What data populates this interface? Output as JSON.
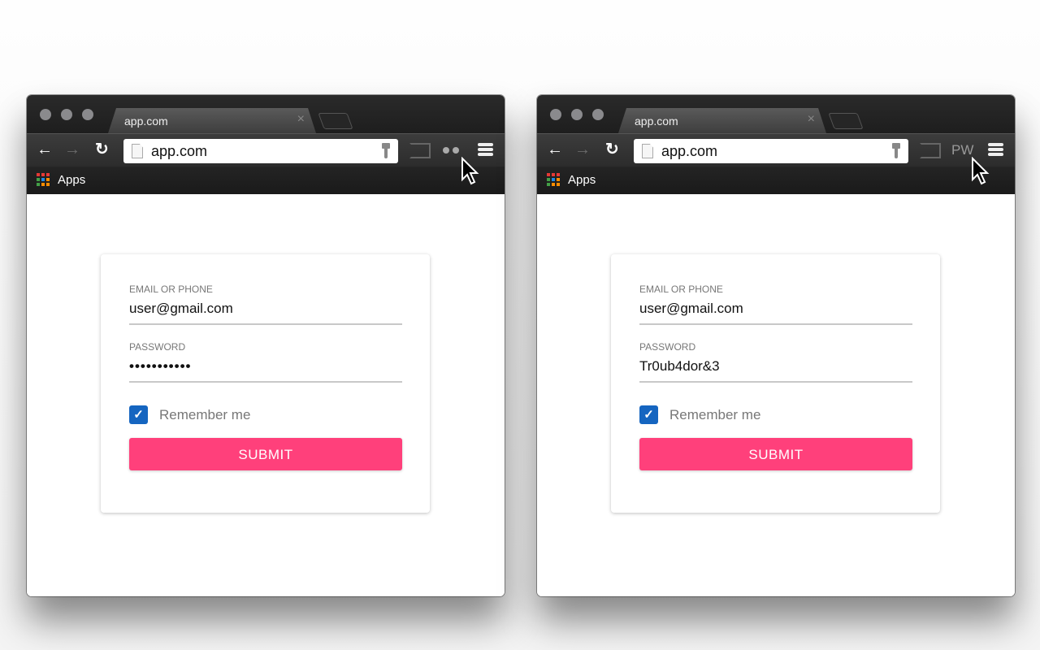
{
  "windows": [
    {
      "tab_title": "app.com",
      "tab_close": "×",
      "url": "app.com",
      "extension": {
        "type": "dots",
        "label": ""
      },
      "bookmarks_label": "Apps",
      "form": {
        "email_label": "EMAIL OR PHONE",
        "email_value": "user@gmail.com",
        "password_label": "PASSWORD",
        "password_value": "•••••••••••",
        "remember_label": "Remember me",
        "remember_checked": true,
        "checkmark": "✓",
        "submit_label": "SUBMIT"
      }
    },
    {
      "tab_title": "app.com",
      "tab_close": "×",
      "url": "app.com",
      "extension": {
        "type": "text",
        "label": "PW"
      },
      "bookmarks_label": "Apps",
      "form": {
        "email_label": "EMAIL OR PHONE",
        "email_value": "user@gmail.com",
        "password_label": "PASSWORD",
        "password_value": "Tr0ub4dor&3",
        "remember_label": "Remember me",
        "remember_checked": true,
        "checkmark": "✓",
        "submit_label": "SUBMIT"
      }
    }
  ],
  "icons": {
    "back": "🡐",
    "forward": "🡒",
    "reload": "↻"
  },
  "colors": {
    "submit": "#ff407b",
    "checkbox": "#1565c0",
    "apps_grid": [
      "#e53935",
      "#e53935",
      "#e53935",
      "#43a047",
      "#1e88e5",
      "#fb8c00",
      "#43a047",
      "#fb8c00",
      "#fb8c00"
    ]
  }
}
